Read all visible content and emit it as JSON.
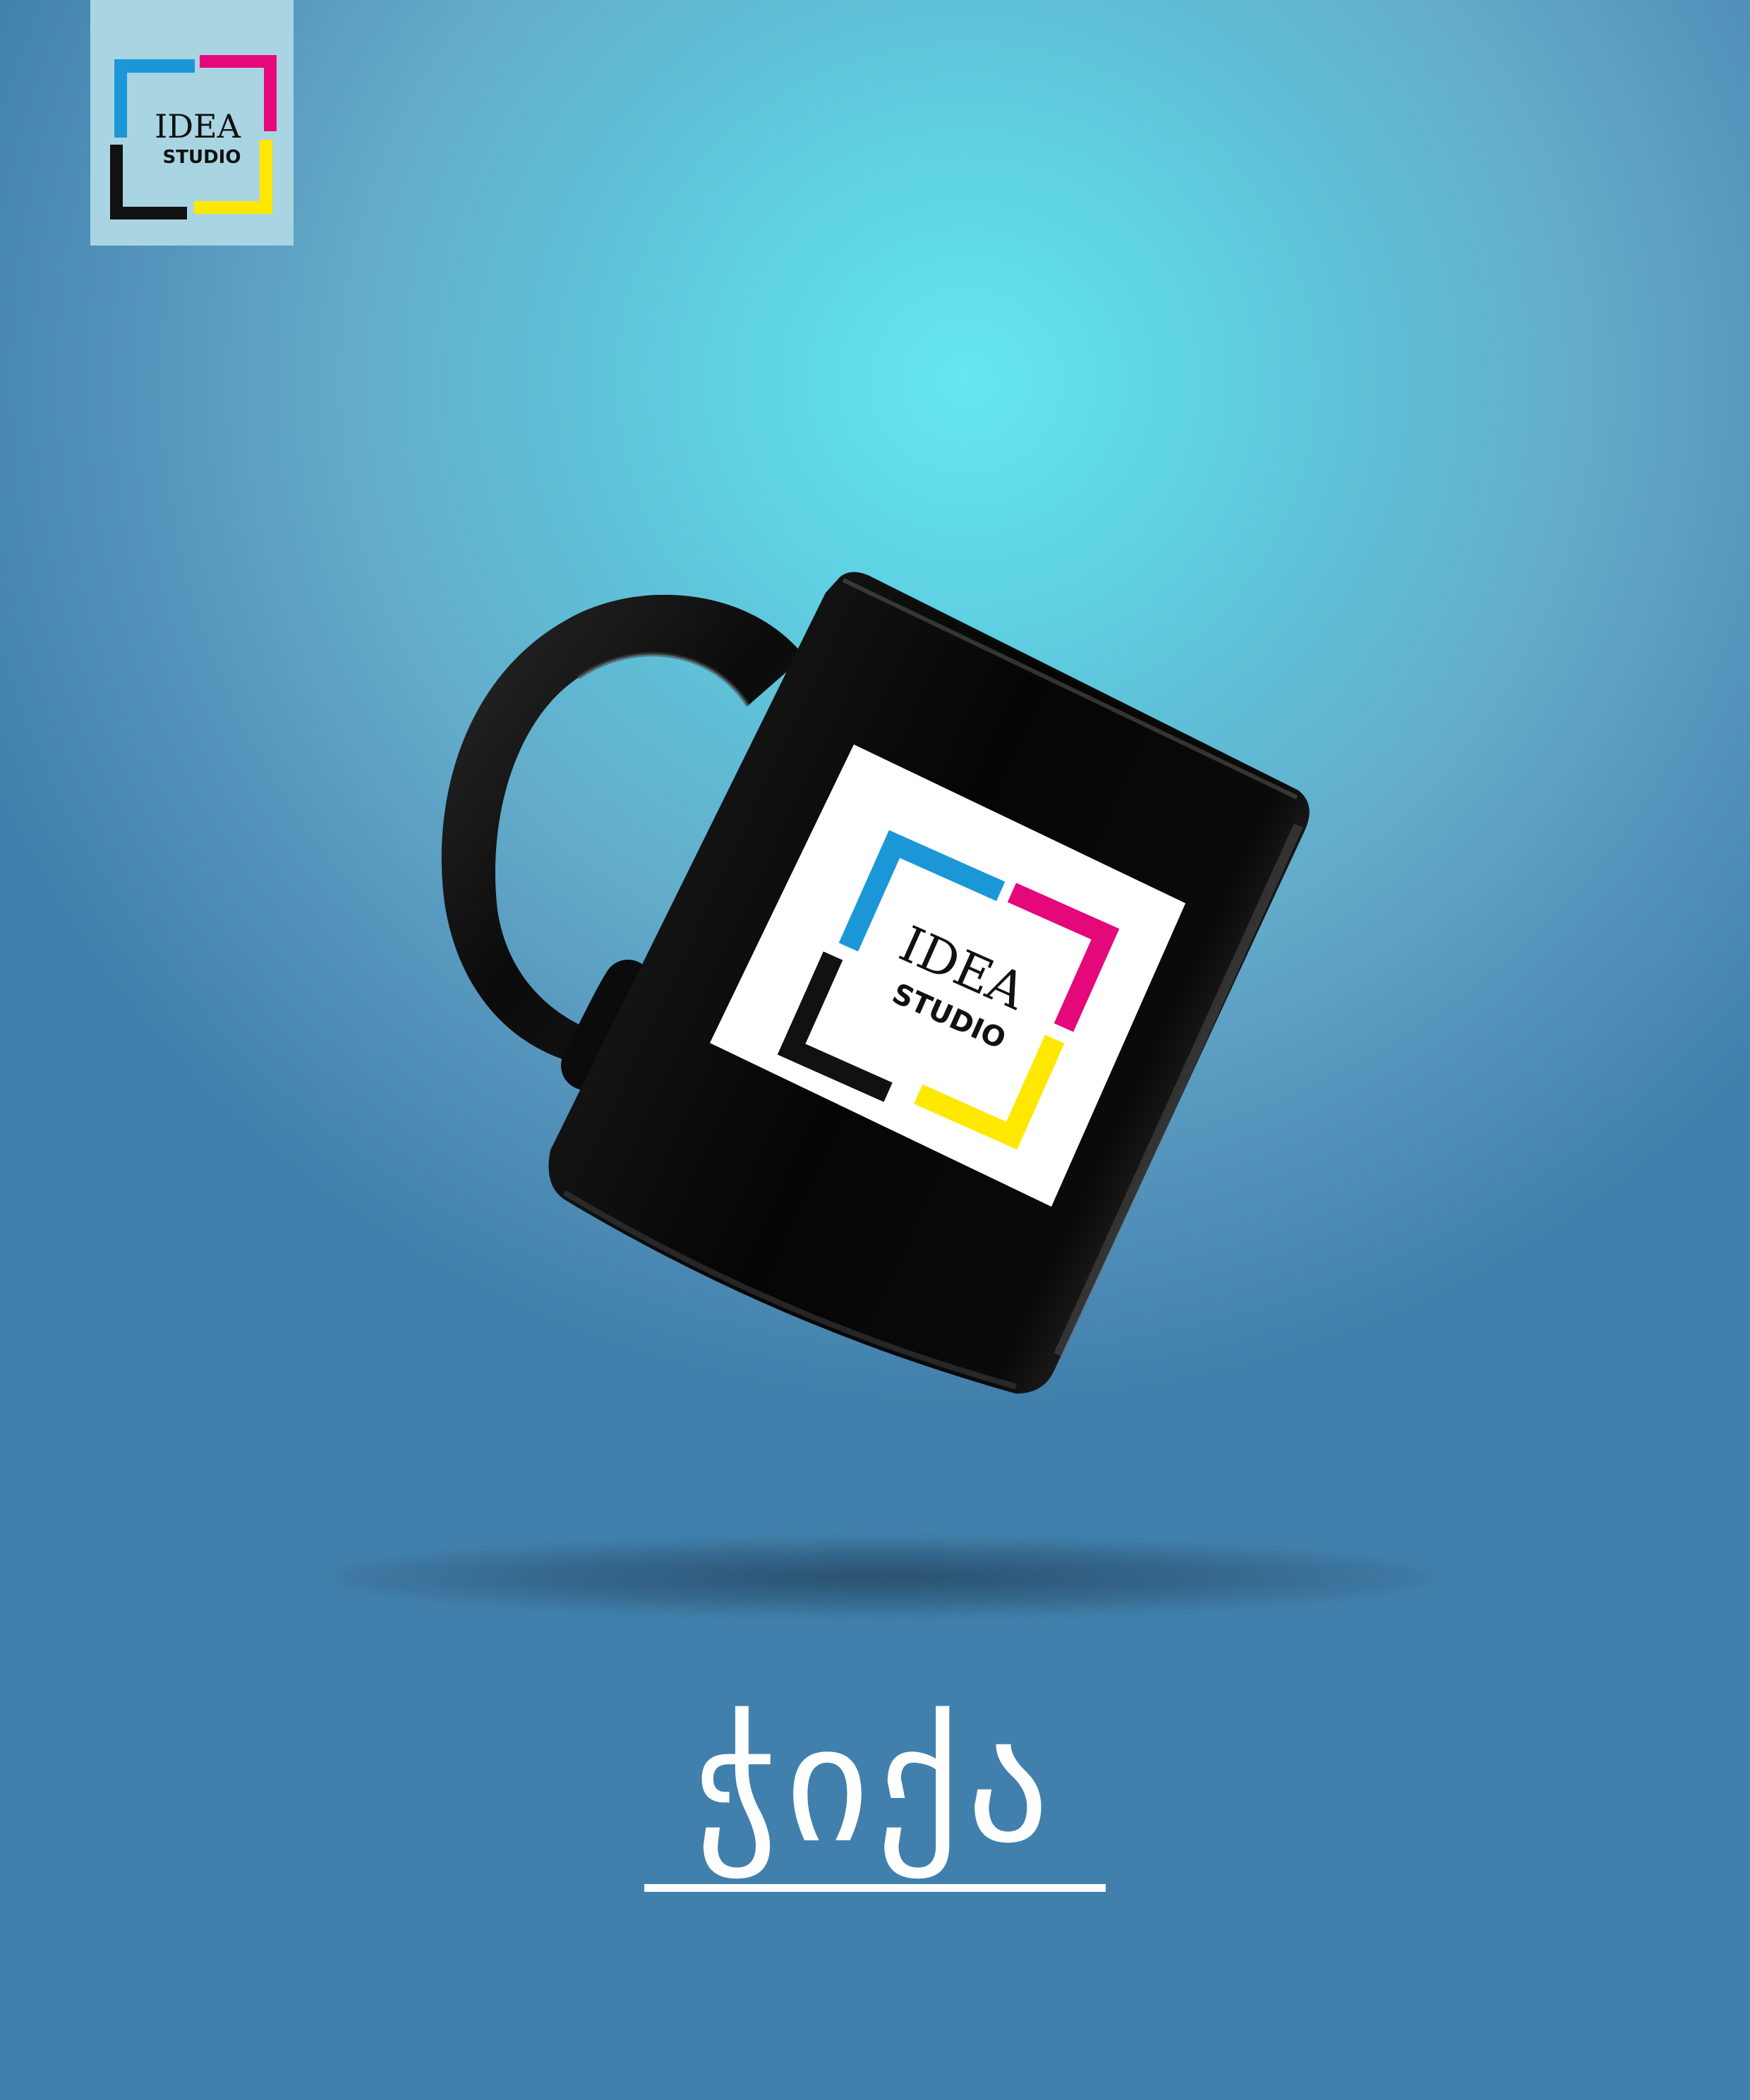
{
  "brand": {
    "logo_line1": "IDEA",
    "logo_line2": "STUDIO",
    "colors": {
      "cyan": "#1b97d8",
      "magenta": "#e4087b",
      "yellow": "#ffe800",
      "black": "#111111"
    }
  },
  "product": {
    "title": "ჭიქა",
    "mug_color": "#0d0d0d"
  },
  "background": {
    "light": "#66e6ee",
    "dark": "#4180ac"
  }
}
